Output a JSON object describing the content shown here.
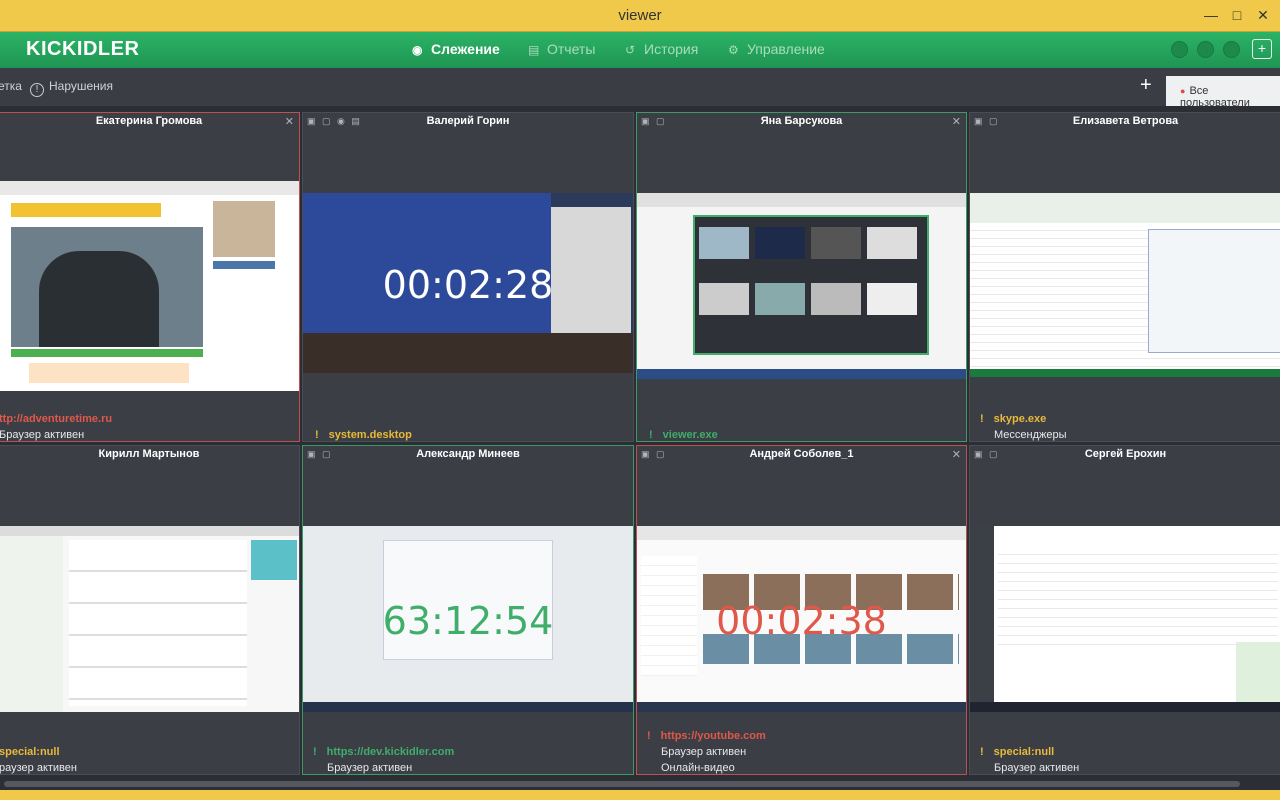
{
  "window": {
    "title": "viewer"
  },
  "nav": {
    "logo": "KICKIDLER",
    "tabs": [
      {
        "label": "Слежение",
        "active": true
      },
      {
        "label": "Отчеты",
        "active": false
      },
      {
        "label": "История",
        "active": false
      },
      {
        "label": "Управление",
        "active": false
      }
    ]
  },
  "toolbar": {
    "left_cut": "етка",
    "violations": "Нарушения",
    "add": "+",
    "users_filter": "Все пользователи"
  },
  "tiles": [
    {
      "name": "Екатерина Громова",
      "status": "red",
      "app": "ttp://adventuretime.ru",
      "app_color": "#e0584a",
      "category": "Браузер активен",
      "timer": "",
      "shot": "browser-adventure"
    },
    {
      "name": "Валерий Горин",
      "status": "none",
      "app": "system.desktop",
      "app_color": "#e8b93a",
      "category": "",
      "timer": "00:02:28",
      "timer_color": "#ffffff",
      "shot": "desktop-blue"
    },
    {
      "name": "Яна Барсукова",
      "status": "green",
      "app": "viewer.exe",
      "app_color": "#3fae6a",
      "category": "",
      "timer": "",
      "shot": "viewer-grid"
    },
    {
      "name": "Елизавета Ветрова",
      "status": "none",
      "app": "skype.exe",
      "app_color": "#e8b93a",
      "category": "Мессенджеры",
      "timer": "",
      "shot": "excel-skype"
    },
    {
      "name": "Кирилл Мартынов",
      "status": "none",
      "app": "special:null",
      "app_color": "#e8b93a",
      "category": "раузер активен",
      "timer": "",
      "shot": "web-form"
    },
    {
      "name": "Александр Минеев",
      "status": "green",
      "app": "https://dev.kickidler.com",
      "app_color": "#3fae6a",
      "category": "Браузер активен",
      "timer": "63:12:54",
      "timer_color": "#3fae6a",
      "shot": "login-page"
    },
    {
      "name": "Андрей Соболев_1",
      "status": "red",
      "app": "https://youtube.com",
      "app_color": "#e0584a",
      "category": "Онлайн-видео",
      "category0": "Браузер активен",
      "timer": "00:02:38",
      "timer_color": "#e0584a",
      "shot": "youtube"
    },
    {
      "name": "Сергей Ерохин",
      "status": "none",
      "app": "special:null",
      "app_color": "#e8b93a",
      "category": "Браузер активен",
      "timer": "",
      "shot": "table-app"
    }
  ]
}
